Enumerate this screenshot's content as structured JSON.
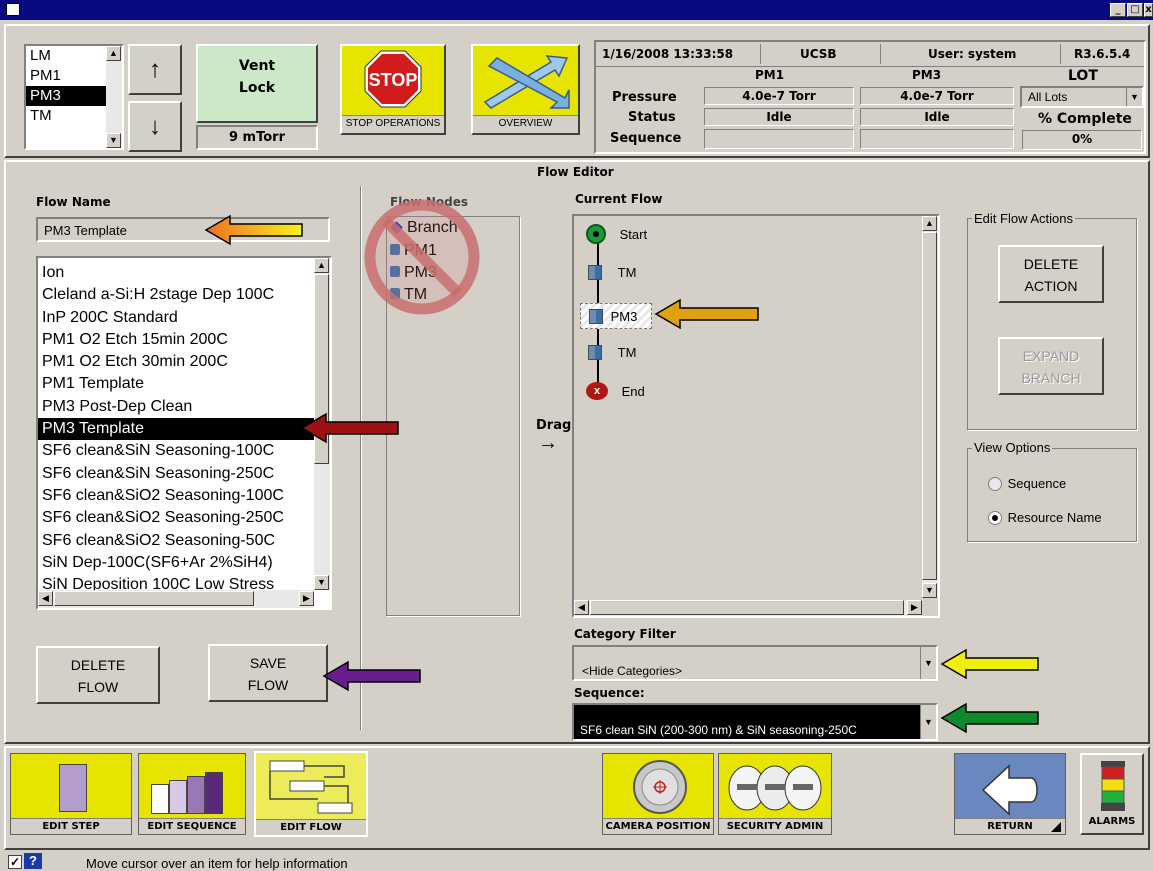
{
  "window": {
    "min": "_",
    "max": "□"
  },
  "modules": {
    "items": [
      "LM",
      "PM1",
      "PM3",
      "TM"
    ],
    "selected_index": 2,
    "up_label": "↑",
    "down_label": "↓",
    "vent_label_1": "Vent",
    "vent_label_2": "Lock",
    "pressure": "9 mTorr"
  },
  "stop": {
    "sign": "STOP",
    "label": "STOP OPERATIONS"
  },
  "overview": {
    "label": "OVERVIEW"
  },
  "status": {
    "datetime": "1/16/2008  13:33:58",
    "site": "UCSB",
    "user": "User: system",
    "version": "R3.6.5.4",
    "col_pm1": "PM1",
    "col_pm3": "PM3",
    "col_lot": "LOT",
    "row_pressure": "Pressure",
    "row_status": "Status",
    "row_sequence": "Sequence",
    "pm1_pressure": "4.0e-7  Torr",
    "pm3_pressure": "4.0e-7  Torr",
    "pm1_status": "Idle",
    "pm3_status": "Idle",
    "lot_select": "All Lots",
    "percent_label": "% Complete",
    "percent_value": "0%"
  },
  "editor": {
    "title": "Flow Editor",
    "flow_name_label": "Flow Name",
    "flow_name_value": "PM3 Template",
    "flows": [
      "Ion",
      "Cleland a-Si:H 2stage Dep 100C",
      "InP 200C Standard",
      "PM1 O2 Etch 15min 200C",
      "PM1 O2 Etch 30min 200C",
      "PM1 Template",
      "PM3 Post-Dep Clean",
      "PM3 Template",
      "SF6 clean&SiN Seasoning-100C",
      "SF6 clean&SiN Seasoning-250C",
      "SF6 clean&SiO2 Seasoning-100C",
      "SF6 clean&SiO2 Seasoning-250C",
      "SF6 clean&SiO2 Seasoning-50C",
      "SiN Dep-100C(SF6+Ar 2%SiH4)",
      "SiN Deposition 100C Low Stress"
    ],
    "selected_flow_index": 7,
    "delete_flow_1": "DELETE",
    "delete_flow_2": "FLOW",
    "save_flow_1": "SAVE",
    "save_flow_2": "FLOW",
    "flow_nodes_label": "Flow Nodes",
    "flow_nodes": [
      "Branch",
      "PM1",
      "PM3",
      "TM"
    ],
    "drag_label": "Drag",
    "drag_arrow": "→",
    "current_flow_label": "Current Flow",
    "current_flow": [
      "Start",
      "TM",
      "PM3",
      "TM",
      "End"
    ],
    "edit_actions_label": "Edit Flow Actions",
    "delete_action_1": "DELETE",
    "delete_action_2": "ACTION",
    "expand_branch_1": "EXPAND",
    "expand_branch_2": "BRANCH",
    "view_options_label": "View Options",
    "opt_sequence": "Sequence",
    "opt_resource": "Resource Name",
    "category_filter_label": "Category Filter",
    "category_filter_value": "<Hide Categories>",
    "sequence_label": "Sequence:",
    "sequence_value": "SF6 clean SiN (200-300 nm) & SiN seasoning-250C"
  },
  "toolbar": {
    "edit_step": "EDIT STEP",
    "edit_sequence": "EDIT SEQUENCE",
    "edit_flow": "EDIT FLOW",
    "camera_position": "CAMERA POSITION",
    "security_admin": "SECURITY ADMIN",
    "return": "RETURN",
    "alarms": "ALARMS"
  },
  "statusbar": {
    "check": "✓",
    "help_icon": "?",
    "message": "Move cursor over an item for help information"
  },
  "colors": {
    "title_bar": "#0a0a80",
    "panel": "#d4d0c8",
    "toolbar_yellow": "#e6e400",
    "vent_green": "#cce8c8",
    "return_blue": "#6a87c0"
  }
}
